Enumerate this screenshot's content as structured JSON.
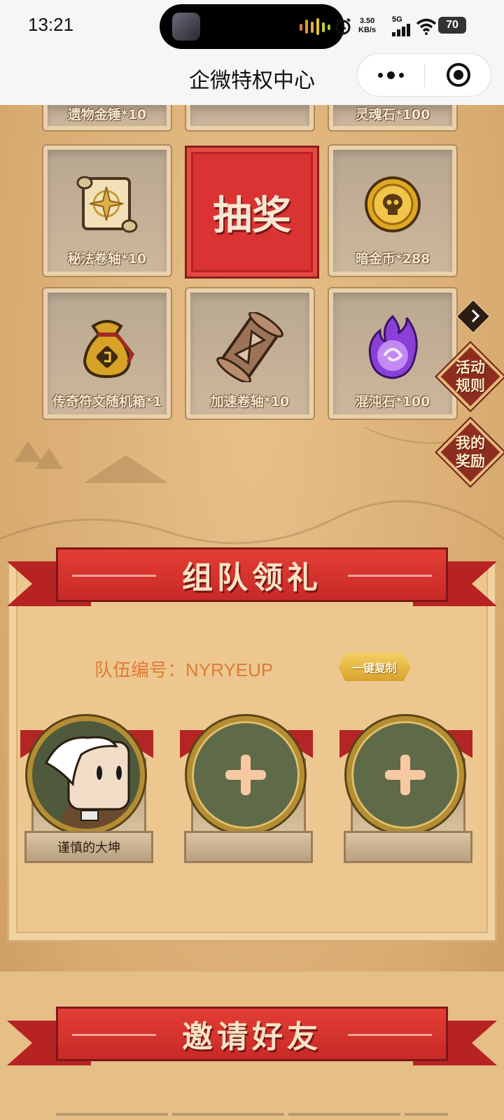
{
  "status_bar": {
    "time": "13:21",
    "net_speed_value": "3.50",
    "net_speed_unit": "KB/s",
    "network": "5G",
    "battery": "70"
  },
  "title_bar": {
    "title": "企微特权中心"
  },
  "prize_grid": {
    "top_row": [
      {
        "label": "遗物金锤*10"
      },
      {
        "label": ""
      },
      {
        "label": "灵魂石*100"
      }
    ],
    "middle_row": [
      {
        "label": "秘法卷轴*10",
        "icon": "scroll-compass-icon"
      },
      {
        "label": "暗金币*288",
        "icon": "skull-coin-icon"
      }
    ],
    "bottom_row": [
      {
        "label": "传奇符文随机箱*1",
        "icon": "rune-bag-icon"
      },
      {
        "label": "加速卷轴*10",
        "icon": "hourglass-scroll-icon"
      },
      {
        "label": "混沌石*100",
        "icon": "purple-flame-icon"
      }
    ],
    "draw_button": "抽奖"
  },
  "side_buttons": {
    "rules": [
      "活动",
      "规则"
    ],
    "rewards": [
      "我的",
      "奖励"
    ]
  },
  "team_section": {
    "banner": "组队领礼",
    "team_id_label": "队伍编号：",
    "team_id": "NYRYEUP",
    "copy_button": "一键复制",
    "members": [
      {
        "name": "谨慎的大坤"
      },
      {
        "name": ""
      },
      {
        "name": ""
      }
    ]
  },
  "invite_section": {
    "banner": "邀请好友"
  },
  "colors": {
    "accent_red": "#d93333",
    "team_id_orange": "#e07a35",
    "gold": "#d9a22b"
  }
}
